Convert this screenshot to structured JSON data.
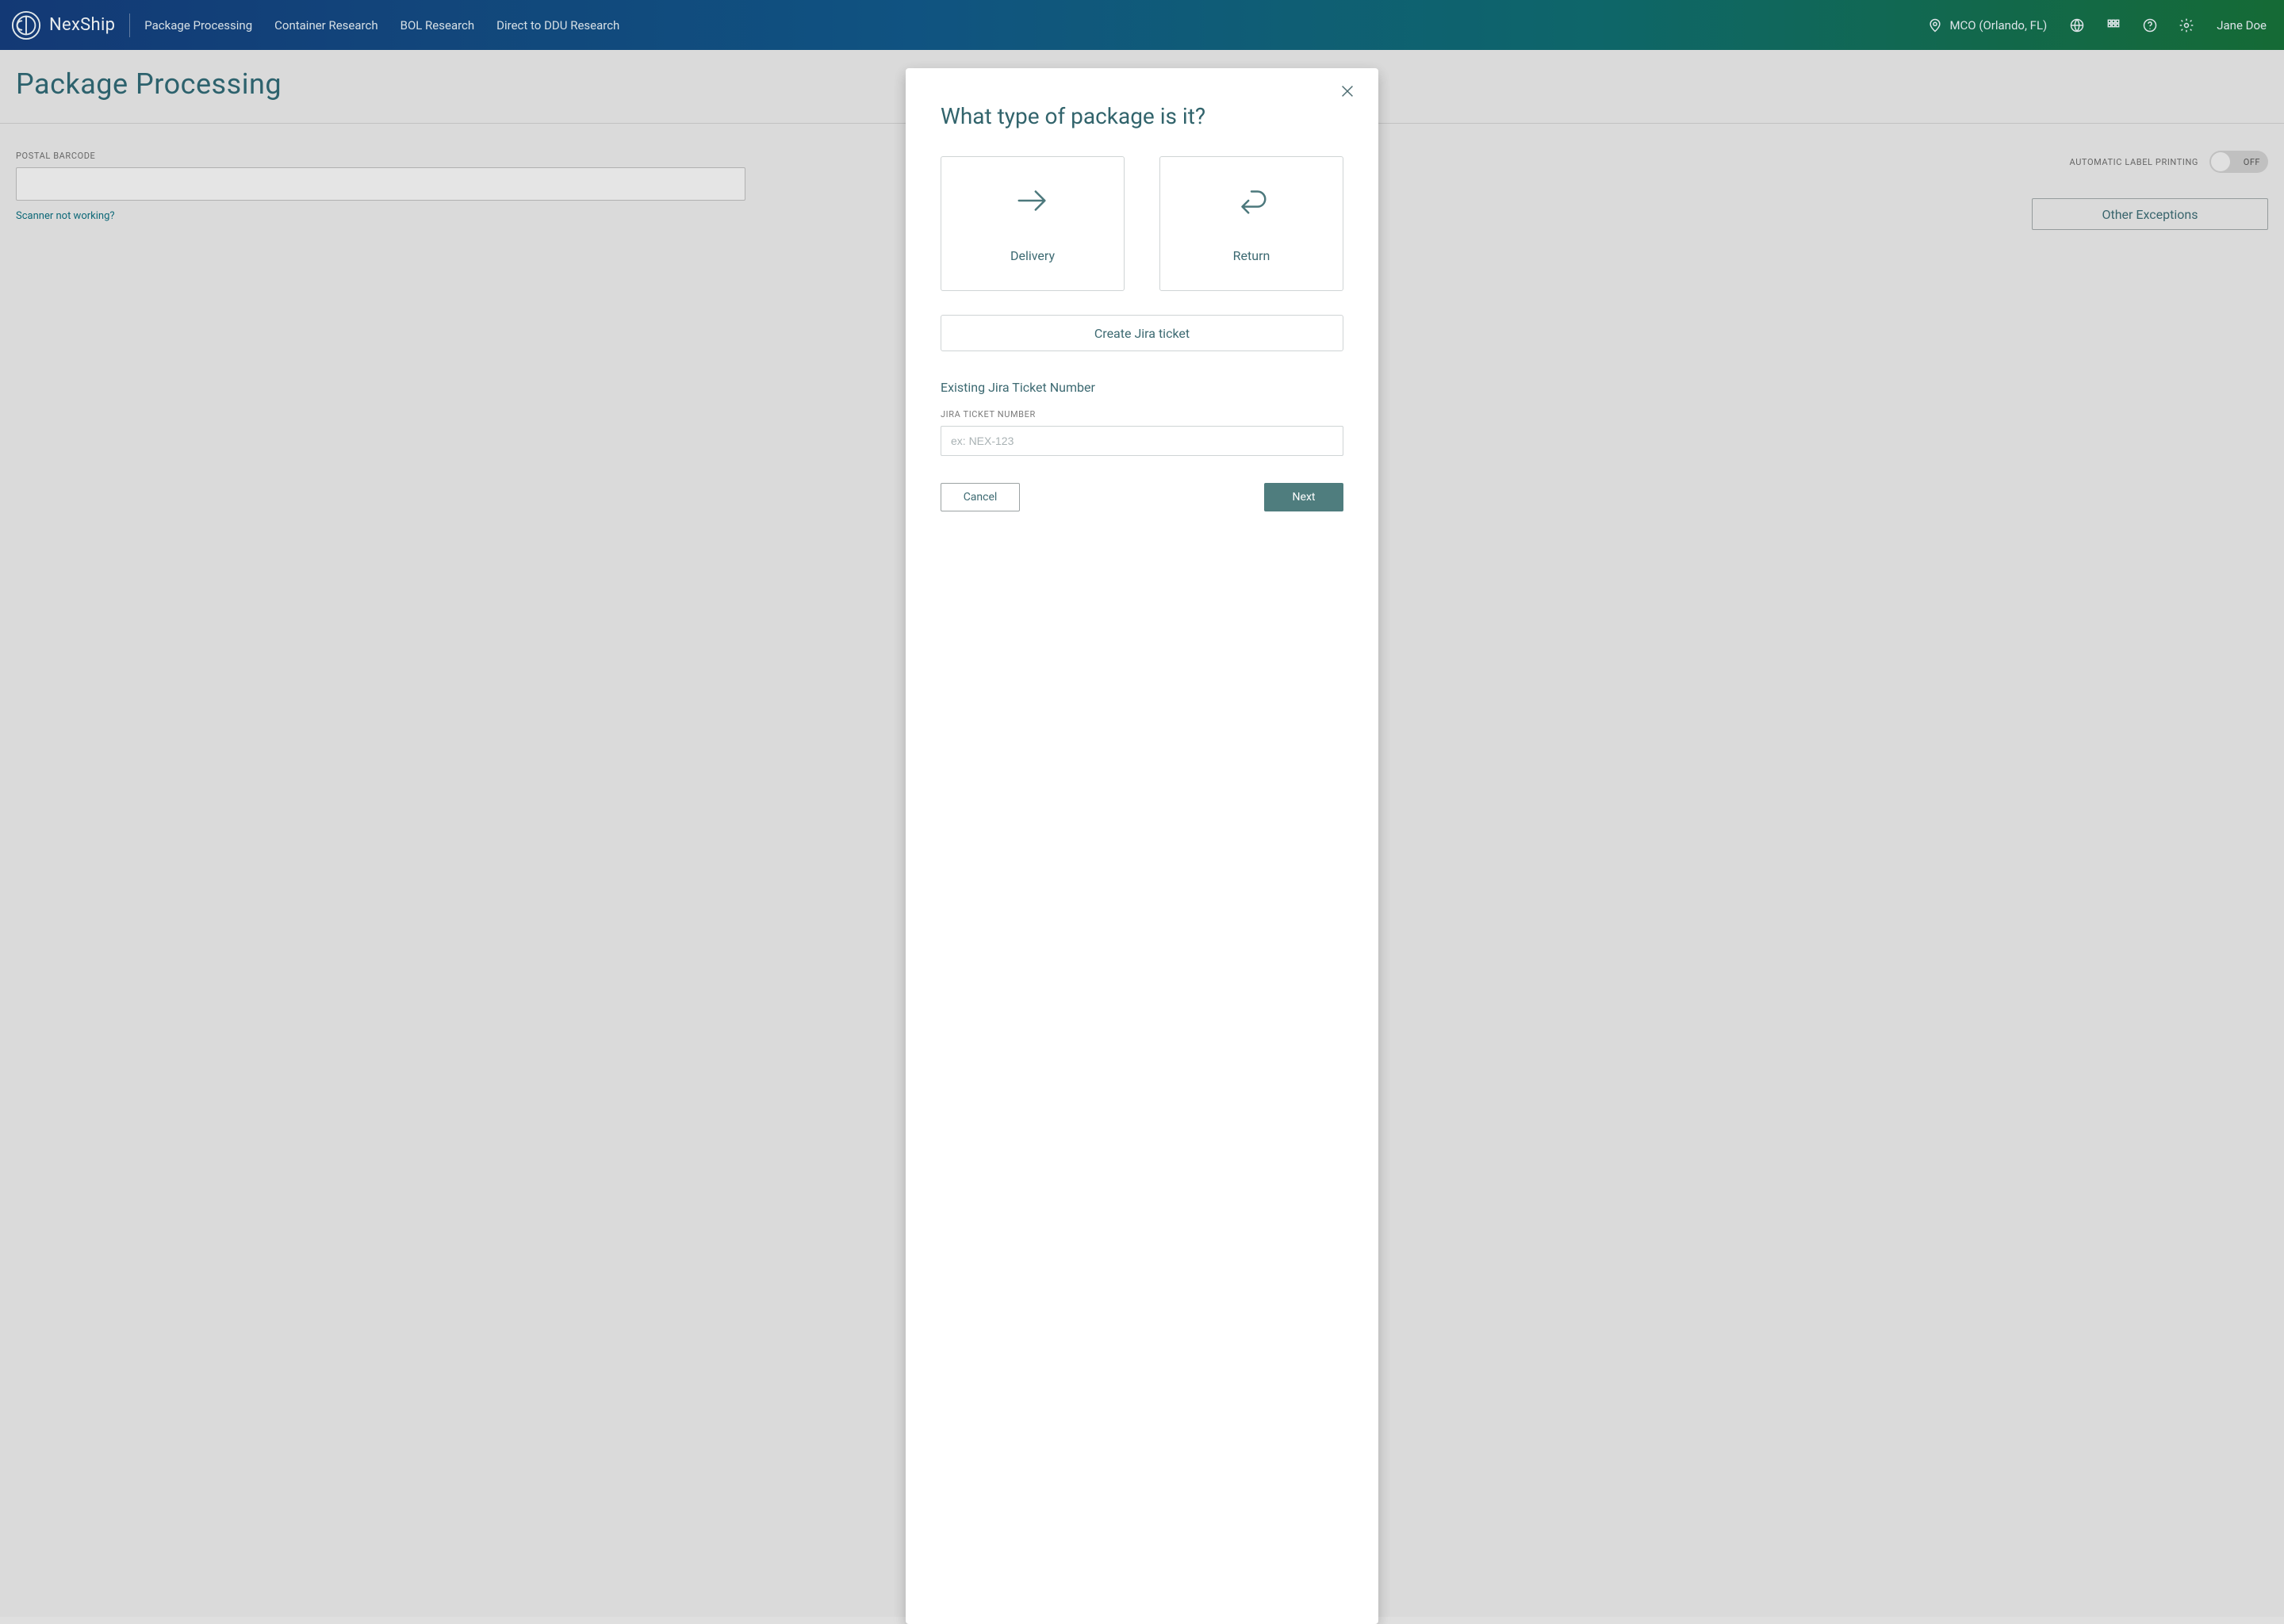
{
  "brand": "NexShip",
  "nav": {
    "package_processing": "Package Processing",
    "container_research": "Container Research",
    "bol_research": "BOL Research",
    "ddu_research": "Direct to DDU Research"
  },
  "location": "MCO (Orlando, FL)",
  "user": "Jane Doe",
  "page_title": "Package Processing",
  "barcode": {
    "label": "POSTAL BARCODE",
    "help_link": "Scanner not working?"
  },
  "auto_label": {
    "label": "AUTOMATIC LABEL PRINTING",
    "state": "OFF"
  },
  "other_exceptions": "Other Exceptions",
  "modal": {
    "title": "What type of package is it?",
    "delivery": "Delivery",
    "return": "Return",
    "create_jira": "Create Jira ticket",
    "existing_header": "Existing Jira Ticket Number",
    "jira_label": "JIRA TICKET NUMBER",
    "jira_placeholder": "ex: NEX-123",
    "cancel": "Cancel",
    "next": "Next"
  }
}
